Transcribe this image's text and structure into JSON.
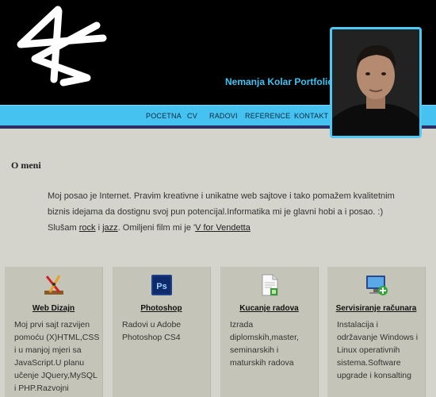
{
  "header": {
    "logo_icon": "ks-monogram-logo",
    "title": "Nemanja Kolar Portfolio",
    "accent_color": "#45c2f0"
  },
  "nav": {
    "items": [
      "POCETNA",
      "CV",
      "RADOVI",
      "REFERENCE",
      "KONTAKT"
    ]
  },
  "profile": {
    "image": "profile-photo"
  },
  "about": {
    "title": "O meni",
    "line1": "Moj posao je Internet. Pravim kreativne i unikatne web sajtove i tako pomažem kvalitetnim",
    "line2": "biznis idejama da dostignu svoj pun potencijal.Informatika mi je glavni hobi a i posao.  :)",
    "line3_prefix": "Slušam ",
    "link_rock": "rock",
    "and": " i ",
    "link_jazz": "jazz",
    "line3_mid": ". Omiljeni film mi je '",
    "link_film": "V for Vendetta"
  },
  "cards": [
    {
      "icon": "web-design-icon",
      "title": "Web Dizajn",
      "lines": [
        "Moj prvi sajt razvijen",
        "pomoću (X)HTML,CSS",
        "i u manjoj mjeri sa",
        "JavaScript.U planu",
        "učenje JQuery,MySQL",
        "i PHP.Razvojni"
      ]
    },
    {
      "icon": "photoshop-icon",
      "title": "Photoshop",
      "lines": [
        "Radovi u Adobe",
        "Photoshop CS4"
      ]
    },
    {
      "icon": "document-icon",
      "title": "Kucanje radova",
      "lines": [
        "Izrada",
        "diplomskih,master,",
        "seminarskih i",
        "maturskih radova"
      ]
    },
    {
      "icon": "computer-service-icon",
      "title": "Servisiranje računara",
      "lines": [
        "Instalacija i",
        "održavanje Windows i",
        "Linux operativnih",
        "sistema.Software",
        "upgrade i konsalting"
      ]
    }
  ]
}
